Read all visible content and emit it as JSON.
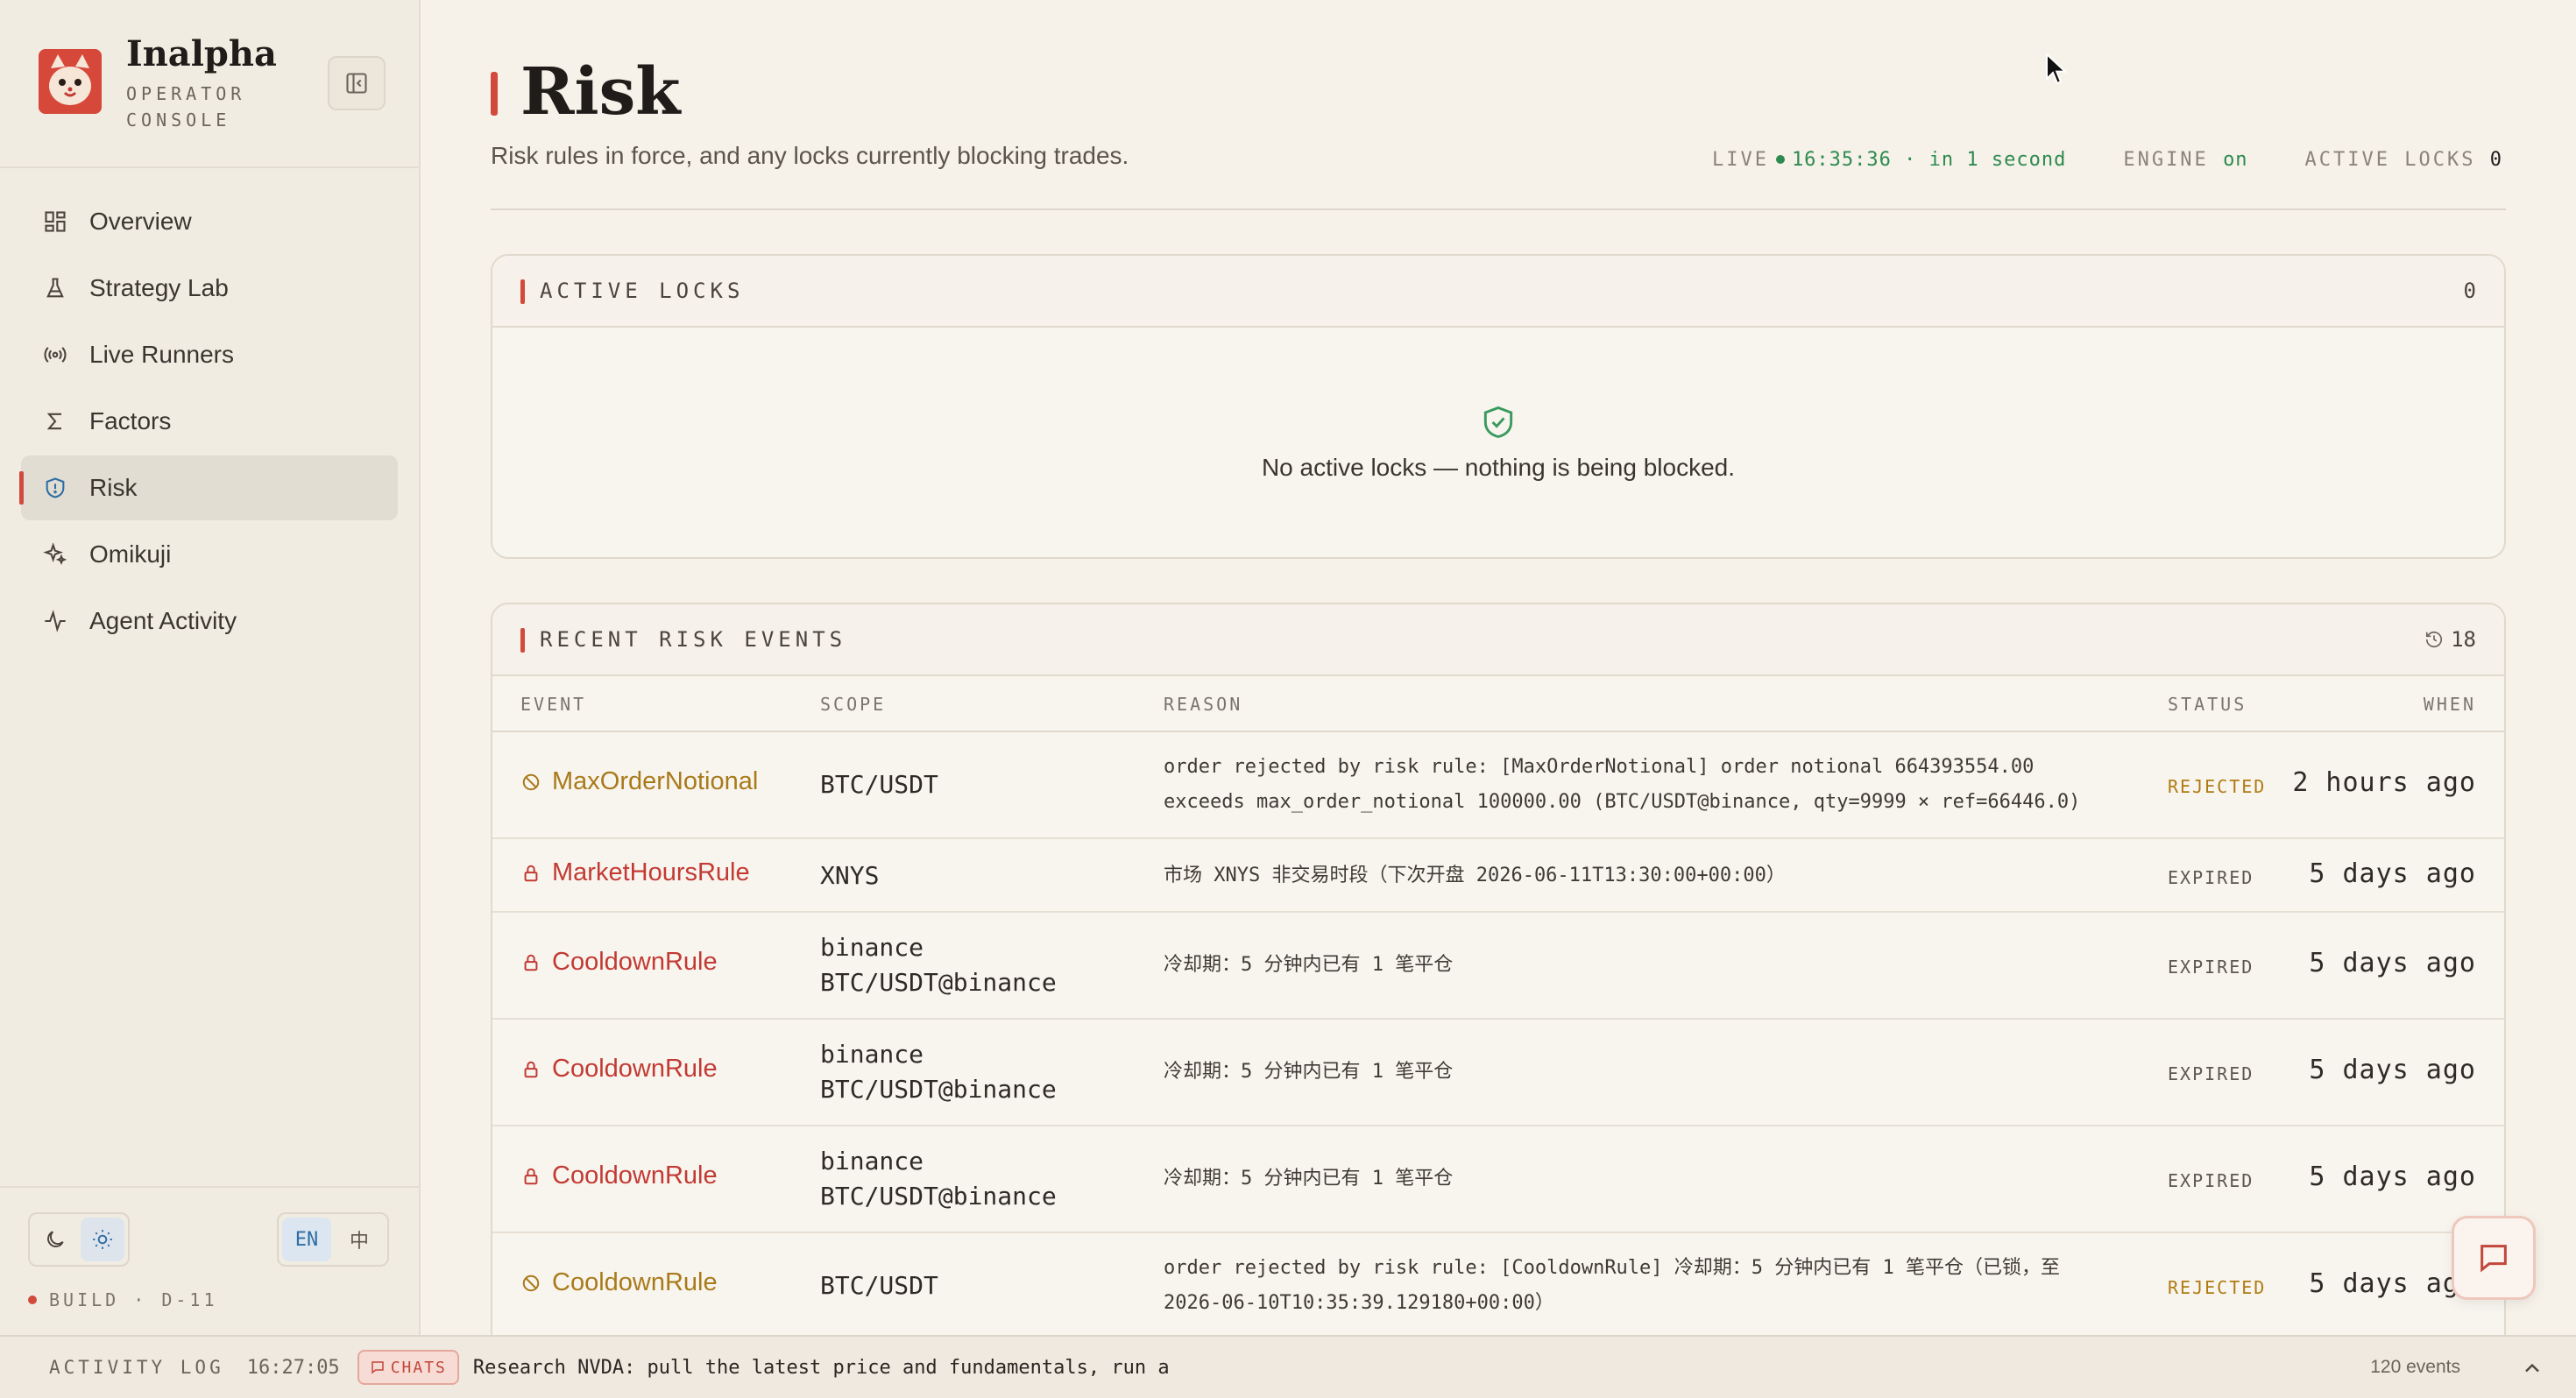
{
  "brand": {
    "name": "Inalpha",
    "subtitle_line1": "OPERATOR",
    "subtitle_line2": "CONSOLE"
  },
  "nav": [
    {
      "label": "Overview",
      "icon": "grid-icon"
    },
    {
      "label": "Strategy Lab",
      "icon": "flask-icon"
    },
    {
      "label": "Live Runners",
      "icon": "broadcast-icon"
    },
    {
      "label": "Factors",
      "icon": "sigma-icon"
    },
    {
      "label": "Risk",
      "icon": "shield-icon",
      "active": true
    },
    {
      "label": "Omikuji",
      "icon": "sparkle-icon"
    },
    {
      "label": "Agent Activity",
      "icon": "pulse-icon"
    }
  ],
  "footer": {
    "lang_en": "EN",
    "lang_zh": "中",
    "build": "BUILD · D-11"
  },
  "header": {
    "title": "Risk",
    "subtitle": "Risk rules in force, and any locks currently blocking trades.",
    "live_label": "LIVE",
    "live_time": "16:35:36 · in 1 second",
    "engine_label": "ENGINE",
    "engine_value": "on",
    "locks_label": "ACTIVE LOCKS",
    "locks_value": "0"
  },
  "active_locks": {
    "title": "ACTIVE LOCKS",
    "count": "0",
    "empty_text": "No active locks — nothing is being blocked."
  },
  "events": {
    "title": "RECENT RISK EVENTS",
    "count": "18",
    "columns": {
      "event": "EVENT",
      "scope": "SCOPE",
      "reason": "REASON",
      "status": "STATUS",
      "when": "WHEN"
    },
    "rows": [
      {
        "event": "MaxOrderNotional",
        "kind": "rej",
        "scope1": "BTC/USDT",
        "scope2": "",
        "reason1": "order rejected by risk rule: [MaxOrderNotional] order notional 664393554.00",
        "reason2": "exceeds max_order_notional 100000.00 (BTC/USDT@binance, qty=9999 × ref=66446.0)",
        "status": "REJECTED",
        "when": "2 hours ago"
      },
      {
        "event": "MarketHoursRule",
        "kind": "exp",
        "scope1": "XNYS",
        "scope2": "",
        "reason1": "市场 XNYS 非交易时段（下次开盘 2026-06-11T13:30:00+00:00）",
        "reason2": "",
        "status": "EXPIRED",
        "when": "5 days ago"
      },
      {
        "event": "CooldownRule",
        "kind": "exp",
        "scope1": "binance",
        "scope2": "BTC/USDT@binance",
        "reason1": "冷却期：5 分钟内已有 1 笔平仓",
        "reason2": "",
        "status": "EXPIRED",
        "when": "5 days ago"
      },
      {
        "event": "CooldownRule",
        "kind": "exp",
        "scope1": "binance",
        "scope2": "BTC/USDT@binance",
        "reason1": "冷却期：5 分钟内已有 1 笔平仓",
        "reason2": "",
        "status": "EXPIRED",
        "when": "5 days ago"
      },
      {
        "event": "CooldownRule",
        "kind": "exp",
        "scope1": "binance",
        "scope2": "BTC/USDT@binance",
        "reason1": "冷却期：5 分钟内已有 1 笔平仓",
        "reason2": "",
        "status": "EXPIRED",
        "when": "5 days ago"
      },
      {
        "event": "CooldownRule",
        "kind": "rej",
        "scope1": "BTC/USDT",
        "scope2": "",
        "reason1": "order rejected by risk rule: [CooldownRule] 冷却期：5 分钟内已有 1 笔平仓（已锁，至",
        "reason2": "2026-06-10T10:35:39.129180+00:00）",
        "status": "REJECTED",
        "when": "5 days ago"
      }
    ]
  },
  "activity": {
    "label": "ACTIVITY LOG",
    "time": "16:27:05",
    "chip": "CHATS",
    "message": "Research NVDA: pull the latest price and fundamentals, run a",
    "events": "120 events"
  },
  "colors": {
    "accent": "#d24a3b",
    "live_green": "#2e8a4e",
    "rejected": "#b07b12",
    "expired_event": "#c23a33"
  }
}
